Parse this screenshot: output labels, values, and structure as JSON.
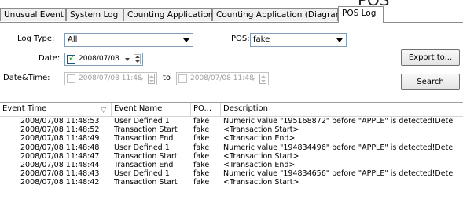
{
  "caption_overlay": "POS",
  "tabs": [
    {
      "label": "Unusual Event",
      "active": false
    },
    {
      "label": "System Log",
      "active": false
    },
    {
      "label": "Counting Application",
      "active": false
    },
    {
      "label": "Counting Application (Diagram)",
      "active": false
    },
    {
      "label": "POS Log",
      "active": true
    }
  ],
  "filters": {
    "log_type_label": "Log Type:",
    "log_type_value": "All",
    "pos_label": "POS:",
    "pos_value": "fake",
    "date_label": "Date:",
    "date_checked": true,
    "date_value": "2008/07/08",
    "datetime_label": "Date&Time:",
    "datetime_from": "2008/07/08 11:48",
    "to_label": "to",
    "datetime_to": "2008/07/08 11:48"
  },
  "buttons": {
    "export": "Export to...",
    "search": "Search"
  },
  "table": {
    "columns": [
      "Event Time",
      "Event Name",
      "PO...",
      "Description"
    ],
    "rows": [
      [
        "2008/07/08 11:48:53",
        "User Defined 1",
        "fake",
        "Numeric value \"195168872\" before \"APPLE\" is detected!Dete"
      ],
      [
        "2008/07/08 11:48:52",
        "Transaction Start",
        "fake",
        "<Transaction Start>"
      ],
      [
        "2008/07/08 11:48:49",
        "Transaction End",
        "fake",
        "<Transaction End>"
      ],
      [
        "2008/07/08 11:48:48",
        "User Defined 1",
        "fake",
        "Numeric value \"194834496\" before \"APPLE\" is detected!Dete"
      ],
      [
        "2008/07/08 11:48:47",
        "Transaction Start",
        "fake",
        "<Transaction Start>"
      ],
      [
        "2008/07/08 11:48:44",
        "Transaction End",
        "fake",
        "<Transaction End>"
      ],
      [
        "2008/07/08 11:48:43",
        "User Defined 1",
        "fake",
        "Numeric value \"194834656\" before \"APPLE\" is detected!Dete"
      ],
      [
        "2008/07/08 11:48:42",
        "Transaction Start",
        "fake",
        "<Transaction Start>"
      ]
    ]
  }
}
